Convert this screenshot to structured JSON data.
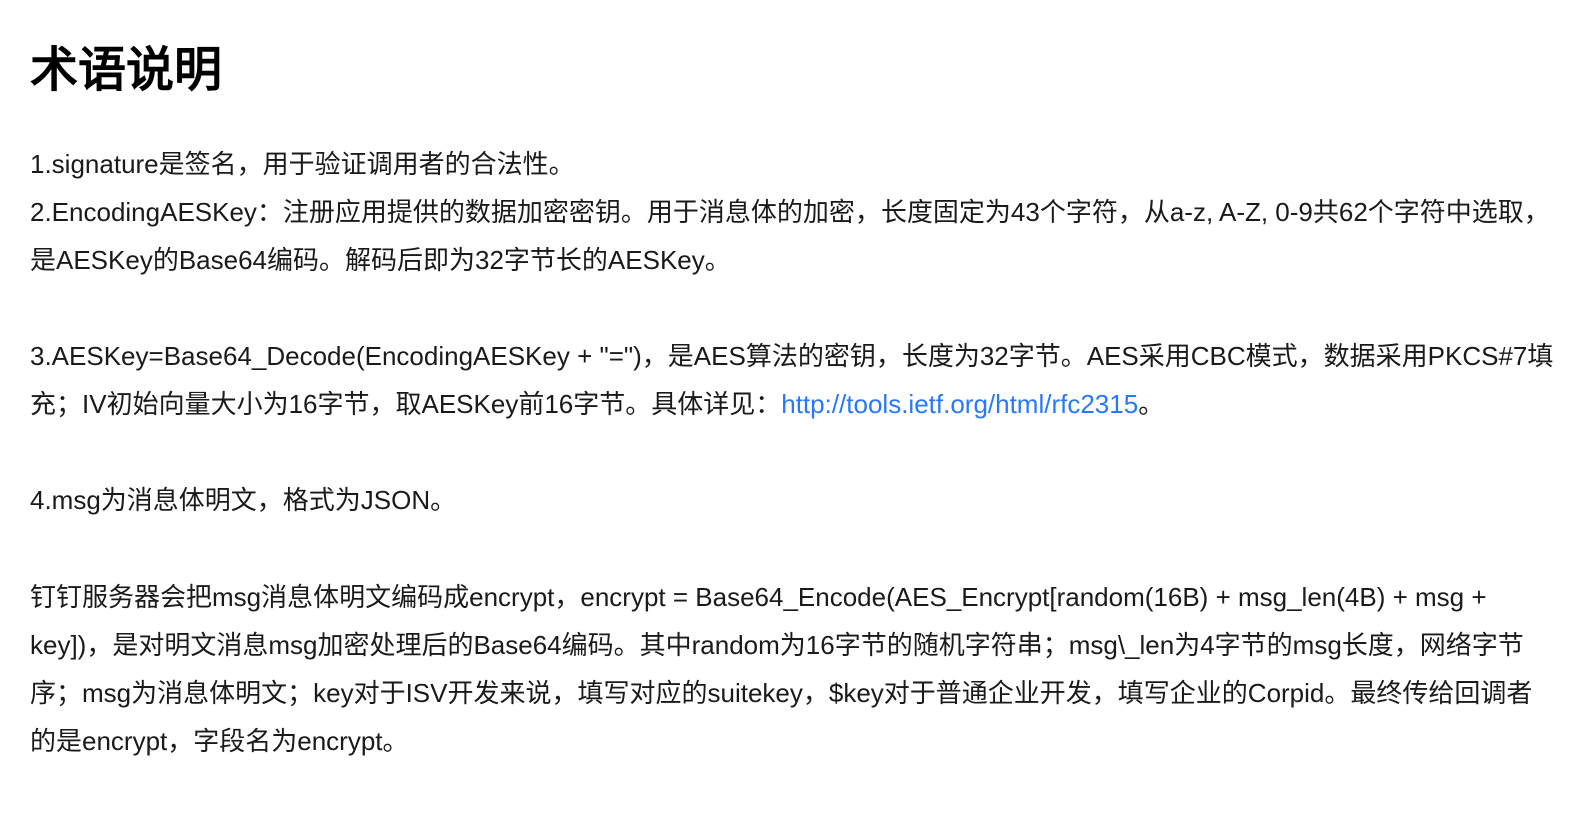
{
  "title": "术语说明",
  "paragraphs": {
    "p1": "1.signature是签名，用于验证调用者的合法性。",
    "p2": "2.EncodingAESKey：注册应用提供的数据加密密钥。用于消息体的加密，长度固定为43个字符，从a-z, A-Z, 0-9共62个字符中选取，是AESKey的Base64编码。解码后即为32字节长的AESKey。",
    "p3_before": "3.AESKey=Base64_Decode(EncodingAESKey + \"=\")，是AES算法的密钥，长度为32字节。AES采用CBC模式，数据采用PKCS#7填充；IV初始向量大小为16字节，取AESKey前16字节。具体详见：",
    "p3_link": "http://tools.ietf.org/html/rfc2315",
    "p3_after": "。",
    "p4": "4.msg为消息体明文，格式为JSON。",
    "p5": "钉钉服务器会把msg消息体明文编码成encrypt，encrypt = Base64_Encode(AES_Encrypt[random(16B) + msg_len(4B) + msg + key])，是对明文消息msg加密处理后的Base64编码。其中random为16字节的随机字符串；msg\\_len为4字节的msg长度，网络字节序；msg为消息体明文；key对于ISV开发来说，填写对应的suitekey，$key对于普通企业开发，填写企业的Corpid。最终传给回调者的是encrypt，字段名为encrypt。"
  }
}
